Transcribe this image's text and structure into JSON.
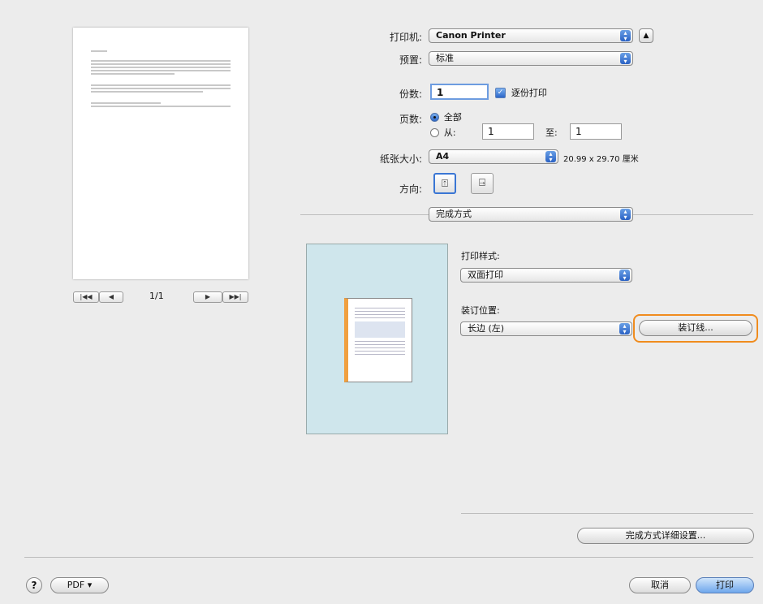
{
  "labels": {
    "printer": "打印机:",
    "presets": "预置:",
    "copies": "份数:",
    "pages": "页数:",
    "paper_size": "纸张大小:",
    "orientation": "方向:",
    "print_style": "打印样式:",
    "binding_location": "装订位置:"
  },
  "printer": {
    "value": "Canon Printer"
  },
  "presets": {
    "value": "标准"
  },
  "copies": {
    "value": "1",
    "collate_label": "逐份打印",
    "collate_checked": true
  },
  "pages": {
    "all_label": "全部",
    "from_label": "从:",
    "from_value": "1",
    "to_label": "至:",
    "to_value": "1",
    "selected": "all"
  },
  "paper_size": {
    "value": "A4",
    "dimensions": "20.99 x 29.70 厘米"
  },
  "panel": {
    "value": "完成方式"
  },
  "print_style": {
    "value": "双面打印"
  },
  "binding_location": {
    "value": "长边 (左)"
  },
  "buttons": {
    "gutter": "装订线...",
    "finishing_details": "完成方式详细设置...",
    "pdf": "PDF ▾",
    "cancel": "取消",
    "print": "打印",
    "help": "?"
  },
  "preview": {
    "page_indicator": "1/1",
    "first": "|◀◀",
    "prev": "◀",
    "next": "▶",
    "last": "▶▶|"
  },
  "colors": {
    "accent": "#3a76d4",
    "highlight": "#f08c1e",
    "preview_bg": "#cfe6ec"
  }
}
